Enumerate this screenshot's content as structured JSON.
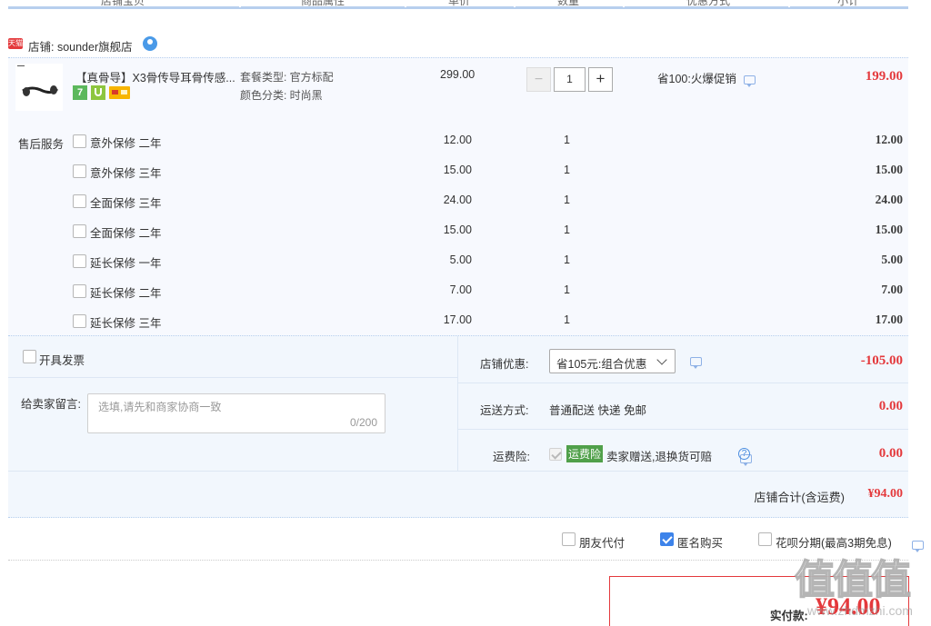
{
  "header_cols": [
    "店铺宝贝",
    "商品属性",
    "单价",
    "数量",
    "优惠方式",
    "小计"
  ],
  "shop": {
    "badge": "天猫",
    "label": "店铺: sounder旗舰店"
  },
  "product": {
    "title": "【真骨导】X3骨传导耳骨传感...",
    "attr1": "套餐类型: 官方标配",
    "attr2": "颜色分类: 时尚黑",
    "price": "299.00",
    "quantity": "1",
    "minus": "−",
    "plus": "+",
    "promo": "省100:火爆促销",
    "subtotal": "199.00",
    "badge_seven": "7"
  },
  "service": {
    "label": "售后服务",
    "items": [
      {
        "name": "意外保修 二年",
        "price": "12.00",
        "qty": "1",
        "subtotal": "12.00"
      },
      {
        "name": "意外保修 三年",
        "price": "15.00",
        "qty": "1",
        "subtotal": "15.00"
      },
      {
        "name": "全面保修 三年",
        "price": "24.00",
        "qty": "1",
        "subtotal": "24.00"
      },
      {
        "name": "全面保修 二年",
        "price": "15.00",
        "qty": "1",
        "subtotal": "15.00"
      },
      {
        "name": "延长保修 一年",
        "price": "5.00",
        "qty": "1",
        "subtotal": "5.00"
      },
      {
        "name": "延长保修 二年",
        "price": "7.00",
        "qty": "1",
        "subtotal": "7.00"
      },
      {
        "name": "延长保修 三年",
        "price": "17.00",
        "qty": "1",
        "subtotal": "17.00"
      }
    ]
  },
  "invoice_label": "开具发票",
  "message": {
    "label": "给卖家留言:",
    "placeholder": "选填,请先和商家协商一致",
    "counter": "0/200"
  },
  "discount": {
    "label": "店铺优惠:",
    "selected": "省105元:组合优惠",
    "amount": "-105.00"
  },
  "shipping": {
    "label": "运送方式:",
    "value": "普通配送 快递 免邮",
    "amount": "0.00"
  },
  "insurance": {
    "label": "运费险:",
    "tag": "运费险",
    "desc": "卖家赠送,退换货可赔",
    "amount": "0.00"
  },
  "shop_total": {
    "label": "店铺合计(含运费)",
    "value": "¥94.00"
  },
  "options": {
    "friend_pay": "朋友代付",
    "anonymous": "匿名购买",
    "huabei": "花呗分期(最高3期免息)"
  },
  "payment": {
    "label": "实付款:",
    "value": "¥94.00"
  },
  "watermark": {
    "logo": "值值值",
    "url": "www.zhdmzhi.com"
  },
  "colors": {
    "accent_red": "#e4393c",
    "panel_blue": "#eef4fd",
    "header_line": "#b7cfee",
    "check_blue": "#3d83ea"
  }
}
